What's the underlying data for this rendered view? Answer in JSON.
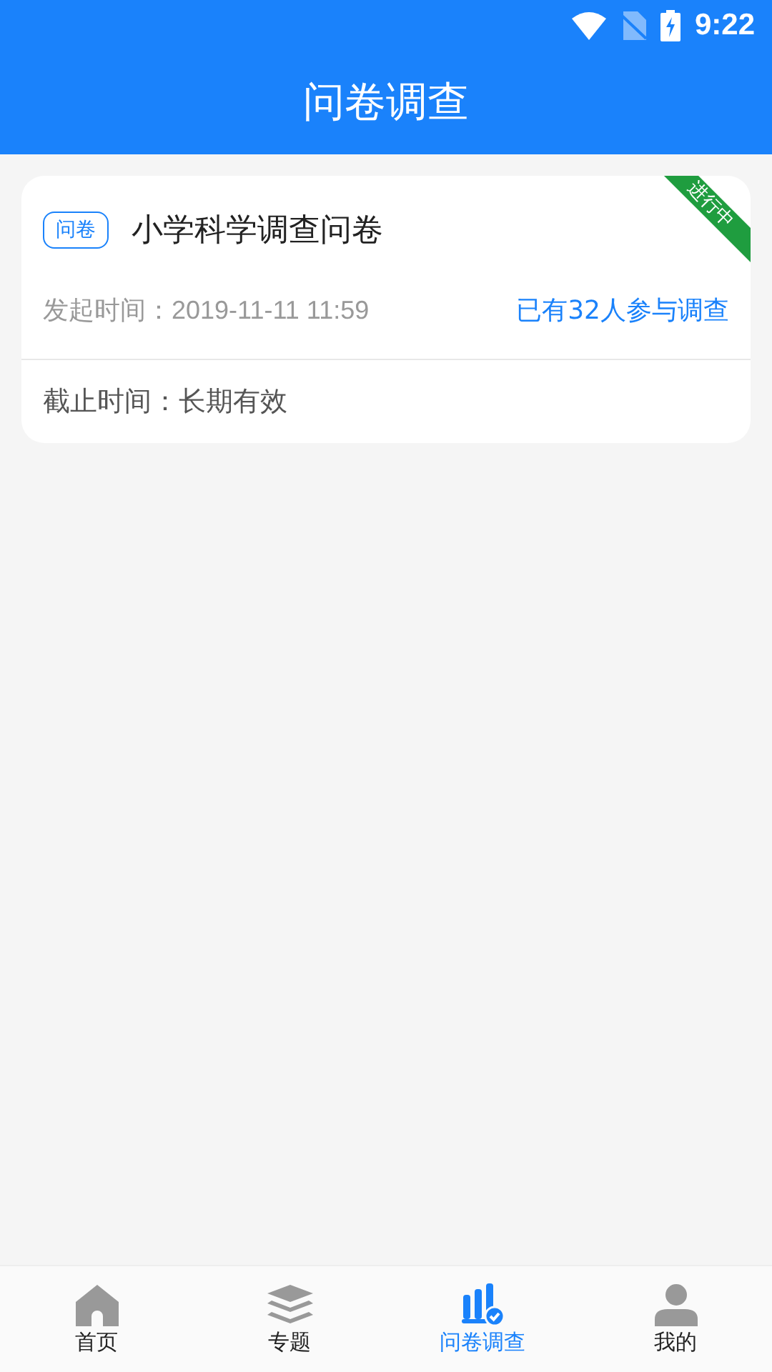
{
  "status_bar": {
    "time": "9:22"
  },
  "header": {
    "title": "问卷调查"
  },
  "surveys": [
    {
      "tag": "问卷",
      "title": "小学科学调查问卷",
      "ribbon": "进行中",
      "start_label": "发起时间：",
      "start_time": "2019-11-11 11:59",
      "participants": "已有32人参与调查",
      "deadline_label": "截止时间：",
      "deadline": "长期有效"
    }
  ],
  "tabs": [
    {
      "kind": "home",
      "label": "首页",
      "selected": false
    },
    {
      "kind": "layers",
      "label": "专题",
      "selected": false
    },
    {
      "kind": "survey",
      "label": "问卷调查",
      "selected": true
    },
    {
      "kind": "user",
      "label": "我的",
      "selected": false
    }
  ]
}
